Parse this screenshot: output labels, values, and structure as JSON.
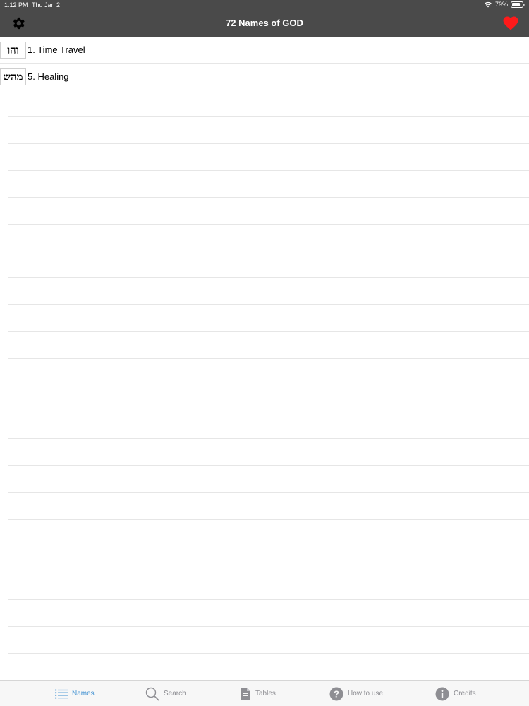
{
  "status_bar": {
    "time": "1:12 PM",
    "date": "Thu Jan 2",
    "battery": "79%",
    "battery_level": 0.79
  },
  "nav": {
    "title": "72 Names of GOD",
    "left_icon": "gear-icon",
    "right_icon": "heart-icon",
    "heart_color": "#ff1a1a"
  },
  "list": {
    "items": [
      {
        "hebrew": "והו",
        "label": "1. Time Travel"
      },
      {
        "hebrew": "מהש",
        "label": "5. Healing"
      }
    ]
  },
  "tabs": [
    {
      "label": "Names",
      "icon": "list-icon",
      "active": true
    },
    {
      "label": "Search",
      "icon": "search-icon",
      "active": false
    },
    {
      "label": "Tables",
      "icon": "document-icon",
      "active": false
    },
    {
      "label": "How to use",
      "icon": "question-icon",
      "active": false
    },
    {
      "label": "Credits",
      "icon": "info-icon",
      "active": false
    }
  ],
  "colors": {
    "nav_background": "#4a4a4a",
    "tab_active": "#3d8fd1",
    "tab_inactive": "#8e8e93"
  }
}
